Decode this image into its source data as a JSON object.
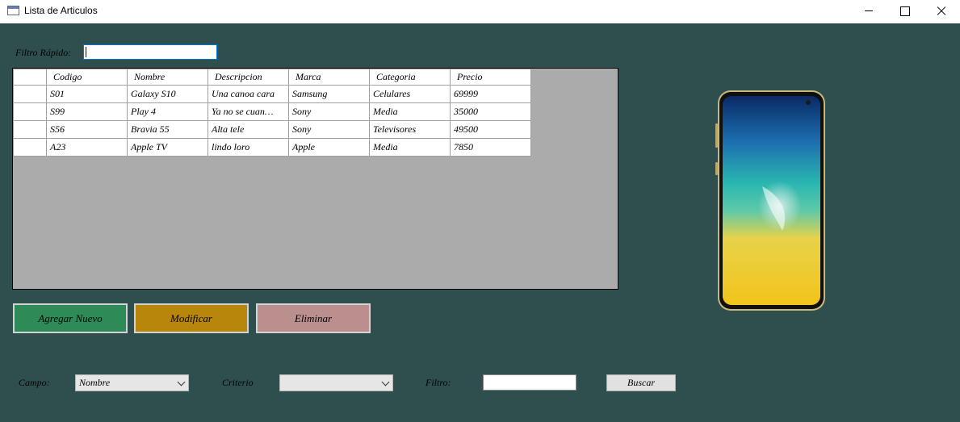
{
  "window": {
    "title": "Lista de Articulos"
  },
  "quick_filter": {
    "label": "Filtro Rápido:",
    "value": ""
  },
  "grid": {
    "columns": [
      "Codigo",
      "Nombre",
      "Descripcion",
      "Marca",
      "Categoria",
      "Precio"
    ],
    "rows": [
      [
        "S01",
        "Galaxy S10",
        "Una canoa cara",
        "Samsung",
        "Celulares",
        "69999"
      ],
      [
        "S99",
        "Play 4",
        "Ya no se cuan…",
        "Sony",
        "Media",
        "35000"
      ],
      [
        "S56",
        "Bravia 55",
        "Alta tele",
        "Sony",
        "Televisores",
        "49500"
      ],
      [
        "A23",
        "Apple TV",
        "lindo loro",
        "Apple",
        "Media",
        "7850"
      ]
    ]
  },
  "buttons": {
    "add": "Agregar Nuevo",
    "modify": "Modificar",
    "delete": "Eliminar",
    "search": "Buscar"
  },
  "search_bar": {
    "campo_label": "Campo:",
    "campo_value": "Nombre",
    "criterio_label": "Criterio",
    "criterio_value": "",
    "filtro_label": "Filtro:",
    "filtro_value": ""
  },
  "colors": {
    "background": "#2f4f4f",
    "add": "#2e8b57",
    "modify": "#b8860b",
    "delete": "#bc8f8f",
    "grid_bg": "#ababab"
  },
  "icons": {
    "phone_image": "smartphone-product-image",
    "app": "window-app-icon"
  }
}
